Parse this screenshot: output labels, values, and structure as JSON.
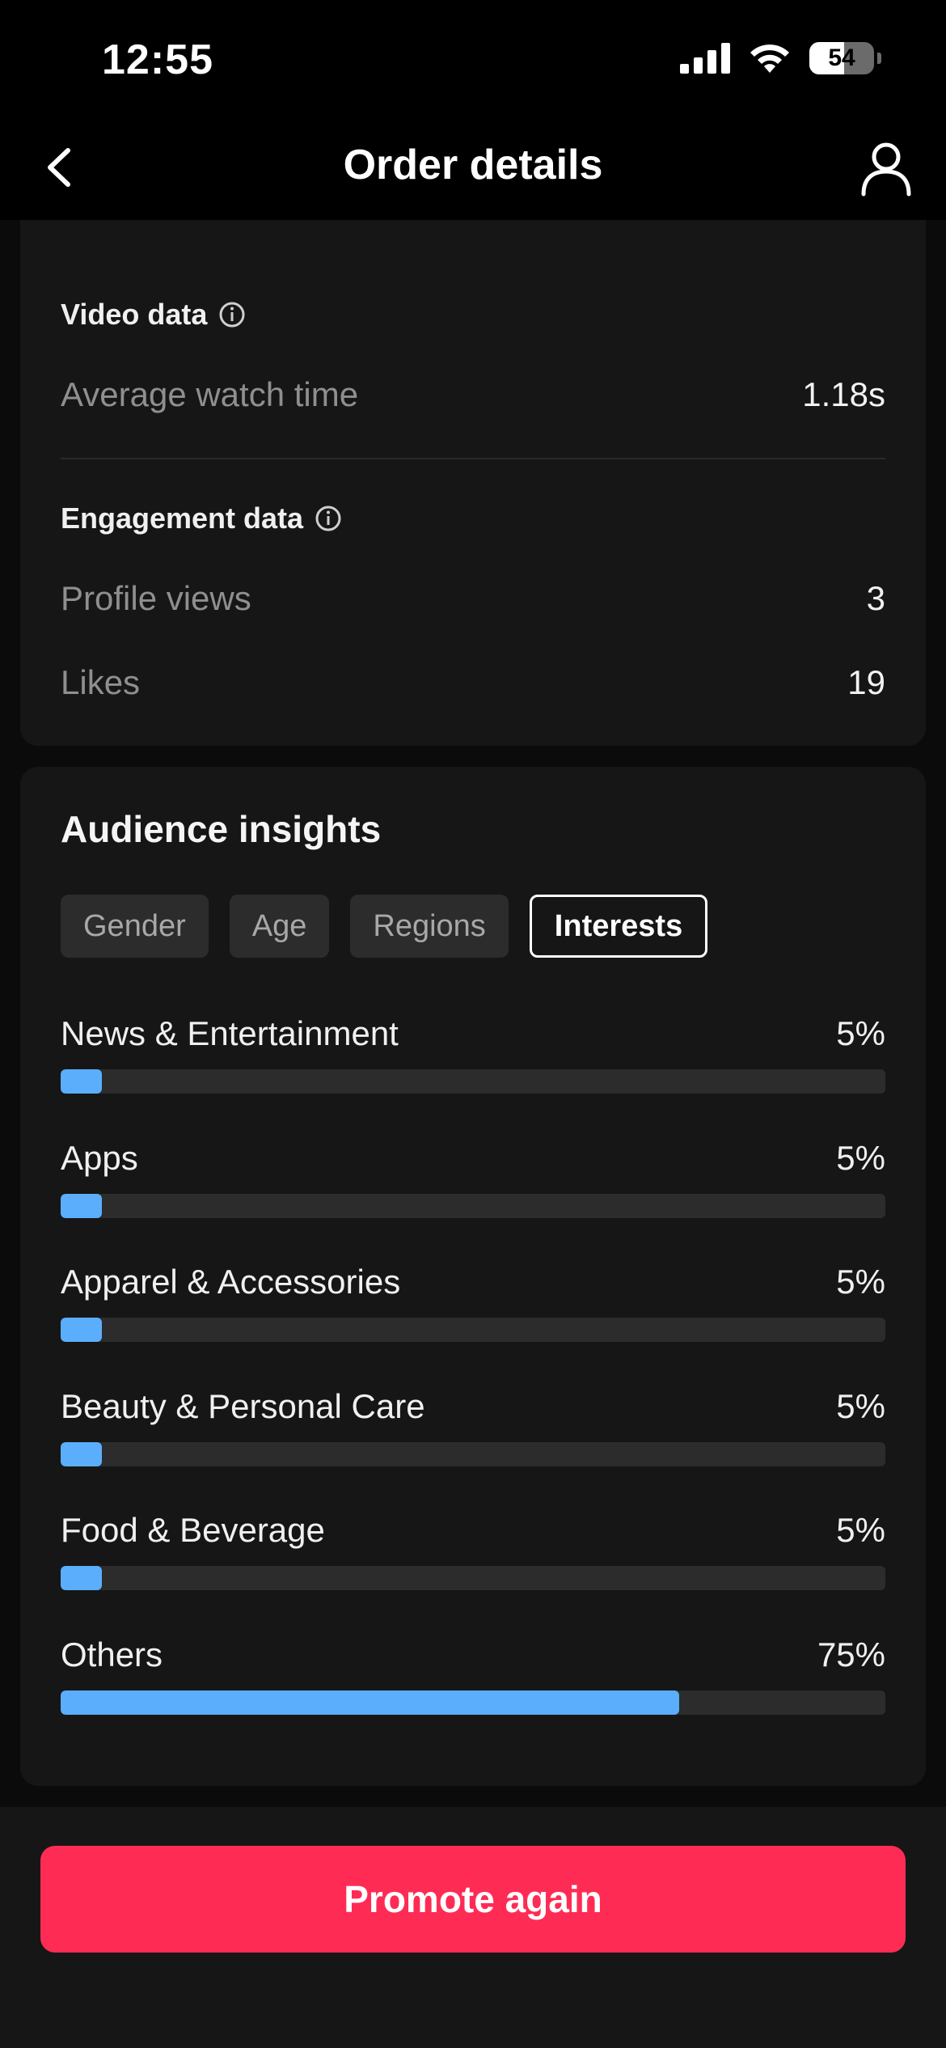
{
  "status_bar": {
    "time": "12:55",
    "battery_level": "54"
  },
  "header": {
    "title": "Order details"
  },
  "video_data": {
    "label": "Video data",
    "rows": [
      {
        "label": "Average watch time",
        "value": "1.18s"
      }
    ]
  },
  "engagement_data": {
    "label": "Engagement data",
    "rows": [
      {
        "label": "Profile views",
        "value": "3"
      },
      {
        "label": "Likes",
        "value": "19"
      }
    ]
  },
  "audience": {
    "title": "Audience insights",
    "tabs": [
      {
        "label": "Gender",
        "active": false
      },
      {
        "label": "Age",
        "active": false
      },
      {
        "label": "Regions",
        "active": false
      },
      {
        "label": "Interests",
        "active": true
      }
    ],
    "items": [
      {
        "label": "News & Entertainment",
        "value": "5%",
        "percent": 5
      },
      {
        "label": "Apps",
        "value": "5%",
        "percent": 5
      },
      {
        "label": "Apparel & Accessories",
        "value": "5%",
        "percent": 5
      },
      {
        "label": "Beauty & Personal Care",
        "value": "5%",
        "percent": 5
      },
      {
        "label": "Food & Beverage",
        "value": "5%",
        "percent": 5
      },
      {
        "label": "Others",
        "value": "75%",
        "percent": 75
      }
    ]
  },
  "footer": {
    "promote_label": "Promote again"
  },
  "colors": {
    "accent": "#fe2c55",
    "bar": "#5aaefc",
    "background": "#000000",
    "card": "#161616"
  }
}
